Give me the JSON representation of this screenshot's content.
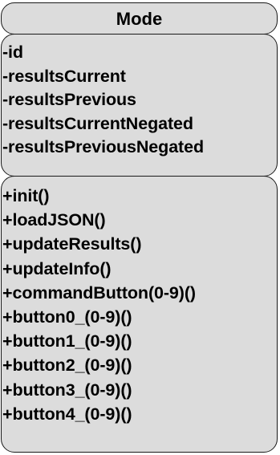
{
  "class": {
    "name": "Mode",
    "attributes": [
      "-id",
      "-resultsCurrent",
      "-resultsPrevious",
      "-resultsCurrentNegated",
      "-resultsPreviousNegated"
    ],
    "operations": [
      "+init()",
      "+loadJSON()",
      "+updateResults()",
      "+updateInfo()",
      "+commandButton(0-9)()",
      "+button0_(0-9)()",
      "+button1_(0-9)()",
      "+button2_(0-9)()",
      "+button3_(0-9)()",
      "+button4_(0-9)()"
    ]
  },
  "colors": {
    "fill": "#dcdcdc",
    "border": "#1a1a1a",
    "text": "#000000"
  }
}
